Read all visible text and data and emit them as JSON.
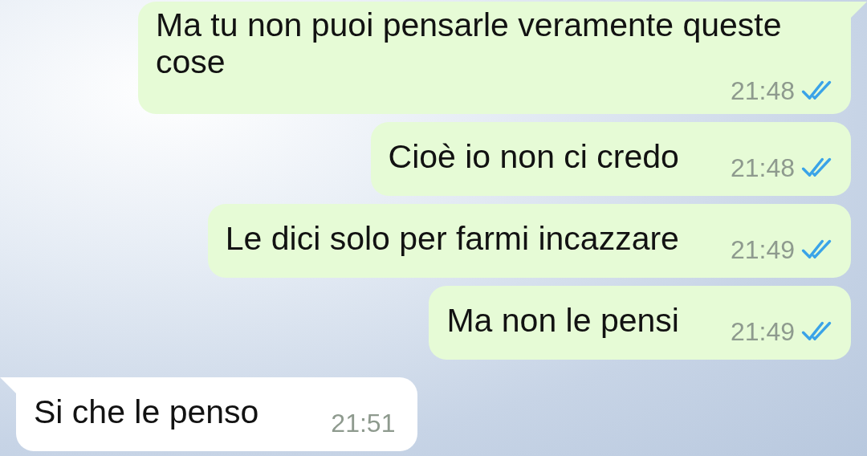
{
  "messages": [
    {
      "outgoing": true,
      "text": "Ma tu non puoi pensarle veramente queste cose",
      "time": "21:48",
      "read": true,
      "tail": true
    },
    {
      "outgoing": true,
      "text": "Cioè io non ci credo",
      "time": "21:48",
      "read": true,
      "tail": false
    },
    {
      "outgoing": true,
      "text": "Le dici solo per farmi incazzare",
      "time": "21:49",
      "read": true,
      "tail": false
    },
    {
      "outgoing": true,
      "text": "Ma non le pensi",
      "time": "21:49",
      "read": true,
      "tail": false
    },
    {
      "outgoing": false,
      "text": "Si che le penso",
      "time": "21:51",
      "tail": true
    }
  ]
}
